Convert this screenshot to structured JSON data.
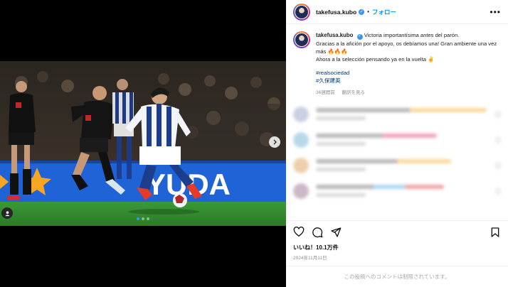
{
  "post": {
    "username": "takefusa.kubo",
    "follow_label": "フォロー",
    "separator": "•",
    "more_label": "•••",
    "caption": {
      "username": "takefusa.kubo",
      "line1": "Victoria importantísima antes del parón.",
      "line2": "Gracias a la afición por el apoyo, os debíamos una! Gran ambiente una vez más 🔥🔥🔥",
      "line3": "Ahora a la selección pensando ya en la vuelta ✌️",
      "hashtag1": "#realsociedad",
      "hashtag2": "#久保建英",
      "age": "36週間前",
      "translate": "翻訳を見る"
    },
    "likes": "いいね！10.1万件",
    "date": "2024年11月11日",
    "comments_closed": "この投稿へのコメントは制限されています。"
  },
  "media": {
    "carousel_dots": 3,
    "active_dot": 1
  },
  "icons": [
    "heart-icon",
    "comment-icon",
    "share-icon",
    "bookmark-icon",
    "more-icon",
    "verified-icon",
    "next-arrow-icon",
    "tagged-user-icon"
  ],
  "colors": {
    "accent": "#0095f6",
    "hashtag": "#00376b",
    "muted": "#8e8e8e",
    "sociedad_blue": "#1c3c8c",
    "pitch_green": "#2f8a2e"
  }
}
